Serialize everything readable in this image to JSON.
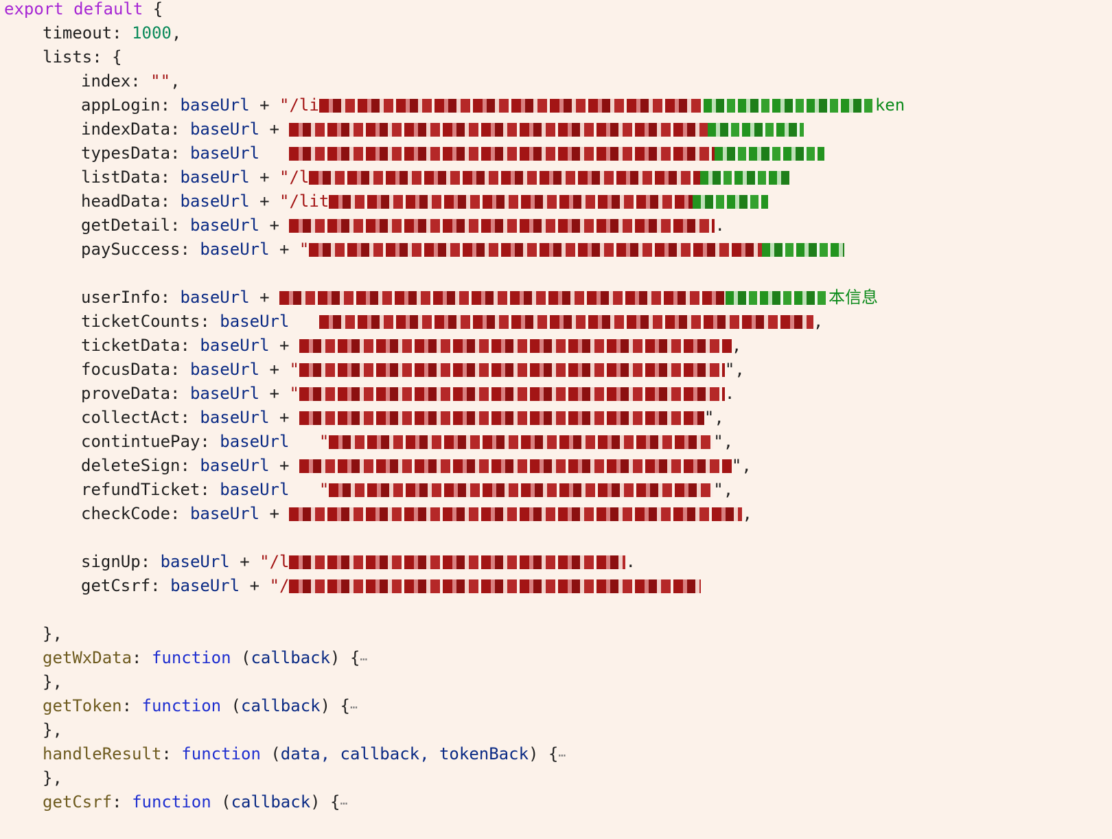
{
  "code": {
    "export": "export default",
    "lbrace": " {",
    "timeout": {
      "key": "timeout",
      "value": "1000"
    },
    "lists_key": "lists",
    "baseUrl": "baseUrl",
    "index": {
      "key": "index",
      "value": "\"\""
    },
    "entries_a": [
      {
        "key": "appLogin",
        "visible_tail": "ken"
      },
      {
        "key": "indexData",
        "visible_tail": ""
      },
      {
        "key": "typesData",
        "visible_tail": ""
      },
      {
        "key": "listData",
        "visible_tail": ""
      },
      {
        "key": "headData",
        "visible_tail": ""
      },
      {
        "key": "getDetail",
        "visible_tail": ""
      },
      {
        "key": "paySuccess",
        "visible_tail": ""
      }
    ],
    "entries_b": [
      {
        "key": "userInfo",
        "visible_tail": "本信息"
      },
      {
        "key": "ticketCounts",
        "visible_tail": ""
      },
      {
        "key": "ticketData",
        "visible_tail": ""
      },
      {
        "key": "focusData",
        "visible_tail": ""
      },
      {
        "key": "proveData",
        "visible_tail": ""
      },
      {
        "key": "collectAct",
        "visible_tail": ""
      },
      {
        "key": "contintuePay",
        "visible_tail": ""
      },
      {
        "key": "deleteSign",
        "visible_tail": ""
      },
      {
        "key": "refundTicket",
        "visible_tail": ""
      },
      {
        "key": "checkCode",
        "visible_tail": ""
      }
    ],
    "entries_c": [
      {
        "key": "signUp",
        "visible_tail": ""
      },
      {
        "key": "getCsrf",
        "visible_tail": ""
      }
    ],
    "functions": [
      {
        "name": "getWxData",
        "params": "callback"
      },
      {
        "name": "getToken",
        "params": "callback"
      },
      {
        "name": "handleResult",
        "params": "data, callback, tokenBack"
      },
      {
        "name": "getCsrf",
        "params": "callback"
      }
    ],
    "function_keyword": "function",
    "fold_marker": "⋯",
    "close_obj": "},"
  }
}
